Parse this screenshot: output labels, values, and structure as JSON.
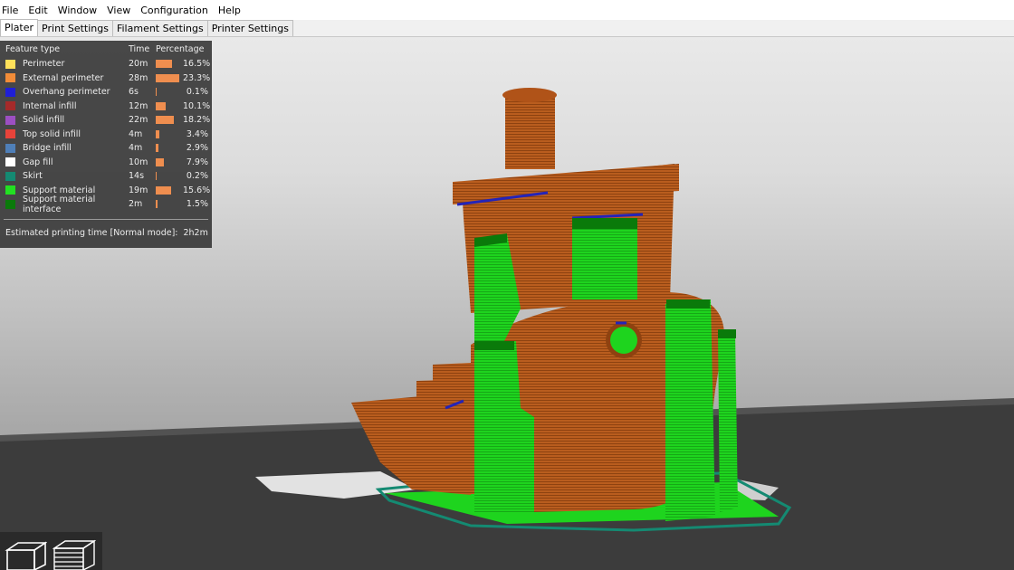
{
  "menubar": {
    "items": [
      "File",
      "Edit",
      "Window",
      "View",
      "Configuration",
      "Help"
    ]
  },
  "tabs": [
    {
      "label": "Plater",
      "active": true
    },
    {
      "label": "Print Settings",
      "active": false
    },
    {
      "label": "Filament Settings",
      "active": false
    },
    {
      "label": "Printer Settings",
      "active": false
    }
  ],
  "legend": {
    "header": {
      "feature": "Feature type",
      "time": "Time",
      "percentage": "Percentage"
    },
    "rows": [
      {
        "feature": "Perimeter",
        "time": "20m",
        "percent": "16.5%",
        "color": "#ffe15a",
        "fraction": 0.165
      },
      {
        "feature": "External perimeter",
        "time": "28m",
        "percent": "23.3%",
        "color": "#f28c38",
        "fraction": 0.233
      },
      {
        "feature": "Overhang perimeter",
        "time": "6s",
        "percent": "0.1%",
        "color": "#1f1fd6",
        "fraction": 0.001
      },
      {
        "feature": "Internal infill",
        "time": "12m",
        "percent": "10.1%",
        "color": "#a52a2a",
        "fraction": 0.101
      },
      {
        "feature": "Solid infill",
        "time": "22m",
        "percent": "18.2%",
        "color": "#9c4fc2",
        "fraction": 0.182
      },
      {
        "feature": "Top solid infill",
        "time": "4m",
        "percent": "3.4%",
        "color": "#e8433a",
        "fraction": 0.034
      },
      {
        "feature": "Bridge infill",
        "time": "4m",
        "percent": "2.9%",
        "color": "#4f7fb8",
        "fraction": 0.029
      },
      {
        "feature": "Gap fill",
        "time": "10m",
        "percent": "7.9%",
        "color": "#ffffff",
        "fraction": 0.079
      },
      {
        "feature": "Skirt",
        "time": "14s",
        "percent": "0.2%",
        "color": "#148a72",
        "fraction": 0.002
      },
      {
        "feature": "Support material",
        "time": "19m",
        "percent": "15.6%",
        "color": "#22e022",
        "fraction": 0.156
      },
      {
        "feature": "Support material interface",
        "time": "2m",
        "percent": "1.5%",
        "color": "#0a7a0a",
        "fraction": 0.015
      }
    ],
    "estimate_label": "Estimated printing time [Normal mode]:",
    "estimate_value": "2h2m"
  },
  "colors": {
    "model": "#b85a1c",
    "support": "#1fd11f",
    "bed": "#3a3a3a"
  },
  "view_buttons": [
    {
      "icon": "cube-3d-view-icon"
    },
    {
      "icon": "layers-view-icon"
    }
  ]
}
